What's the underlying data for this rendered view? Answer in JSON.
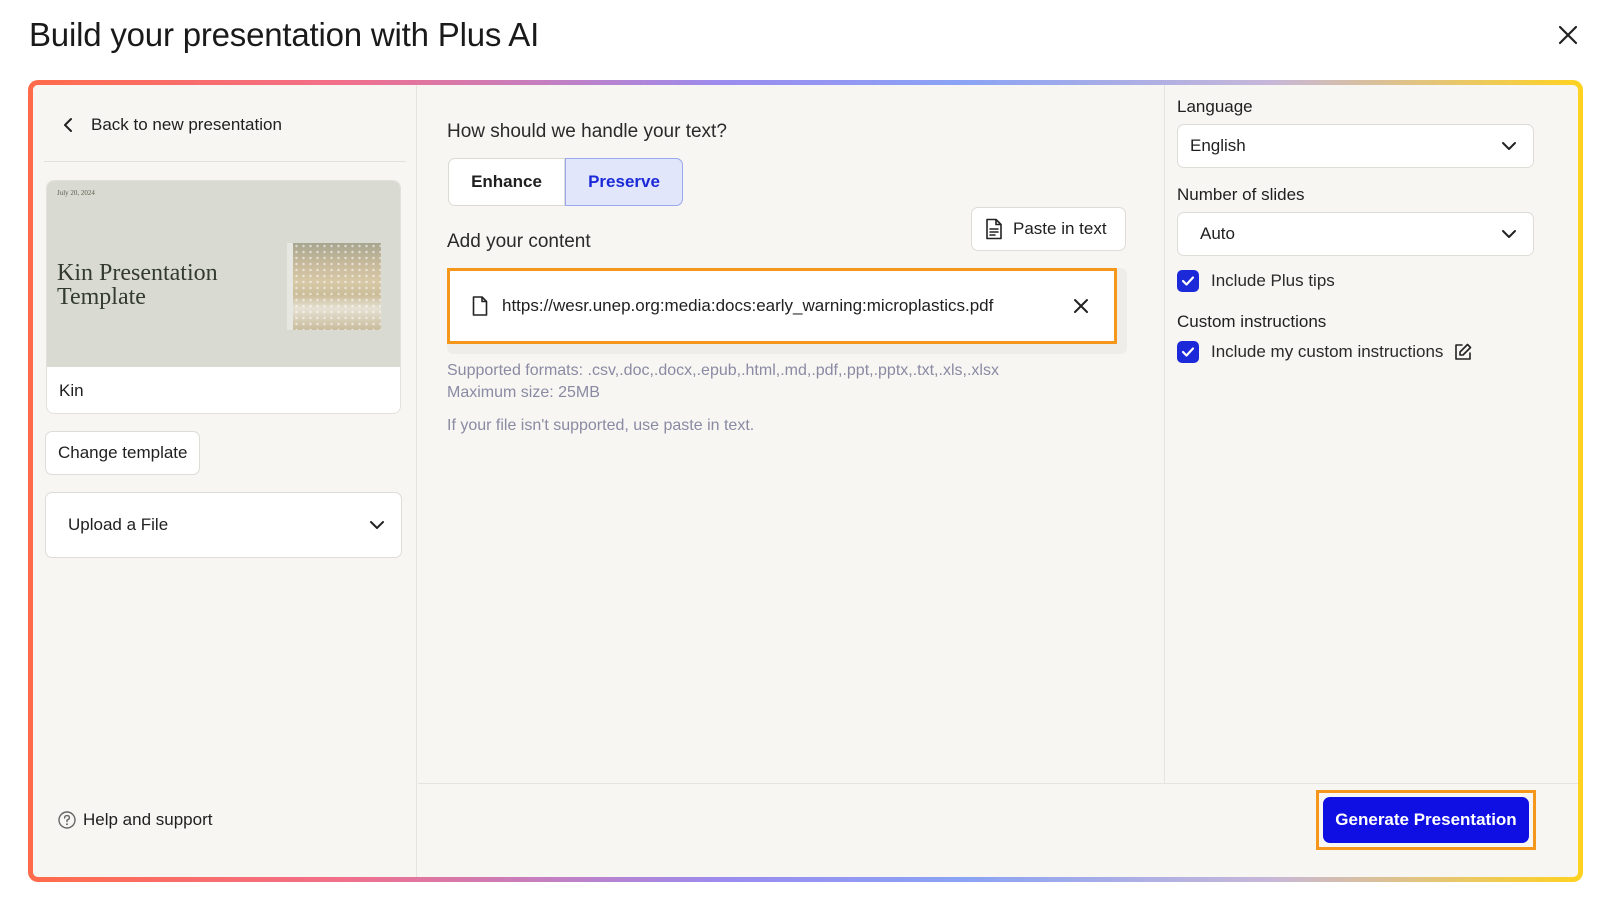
{
  "modal": {
    "title": "Build your presentation with Plus AI"
  },
  "left": {
    "back_label": "Back to new presentation",
    "template": {
      "preview_date": "July 20, 2024",
      "preview_title": "Kin Presentation Template",
      "name": "Kin"
    },
    "change_template_label": "Change template",
    "source_select": "Upload a File",
    "help_label": "Help and support"
  },
  "middle": {
    "question": "How should we handle your text?",
    "modes": [
      "Enhance",
      "Preserve"
    ],
    "selected_mode": "Preserve",
    "content_title": "Add your content",
    "paste_label": "Paste in text",
    "file_url": "https://wesr.unep.org:media:docs:early_warning:microplastics.pdf",
    "supported_formats": "Supported formats: .csv,.doc,.docx,.epub,.html,.md,.pdf,.ppt,.pptx,.txt,.xls,.xlsx",
    "max_size": "Maximum size: 25MB",
    "unsupported_hint": "If your file isn't supported, use paste in text."
  },
  "right": {
    "language_label": "Language",
    "language_value": "English",
    "slides_label": "Number of slides",
    "slides_value": "Auto",
    "include_tips_label": "Include Plus tips",
    "include_tips_checked": true,
    "custom_title": "Custom instructions",
    "include_custom_label": "Include my custom instructions",
    "include_custom_checked": true
  },
  "footer": {
    "generate_label": "Generate Presentation"
  },
  "colors": {
    "accent": "#0f0fe3",
    "highlight": "#f5961d",
    "selected_bg": "#e2e6fb"
  }
}
